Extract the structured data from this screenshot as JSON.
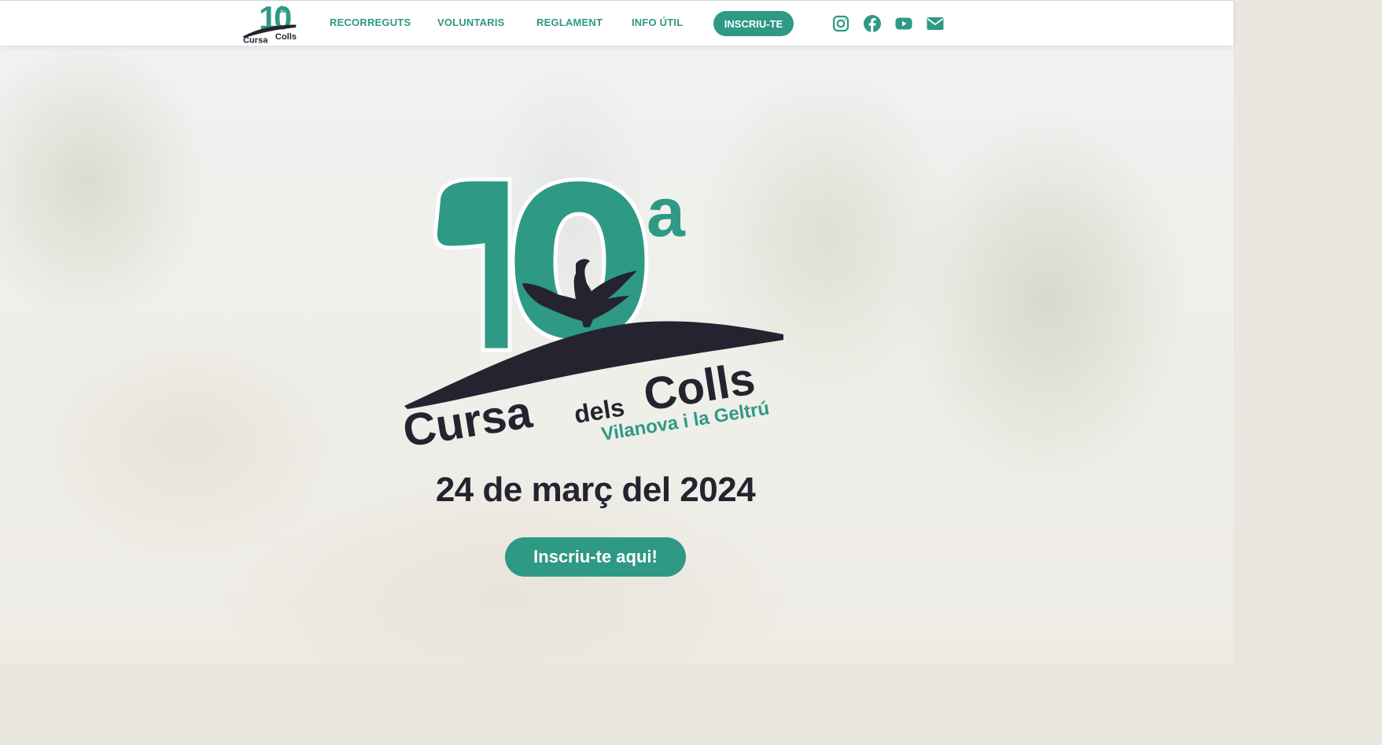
{
  "colors": {
    "accent": "#2e9984",
    "dark": "#25232f",
    "navbar_bg": "#ffffff"
  },
  "navbar": {
    "links": [
      {
        "label": "RECORREGUTS"
      },
      {
        "label": "VOLUNTARIS"
      },
      {
        "label": "REGLAMENT"
      },
      {
        "label": "INFO ÚTIL"
      }
    ],
    "cta_label": "INSCRIU-TE",
    "social": [
      {
        "icon": "instagram-icon"
      },
      {
        "icon": "facebook-icon"
      },
      {
        "icon": "youtube-icon"
      },
      {
        "icon": "email-icon"
      }
    ]
  },
  "logo": {
    "edition": "10",
    "edition_suffix": "a",
    "word1": "Cursa",
    "word2": "dels",
    "word3": "Colls",
    "city": "Vilanova i la Geltrú"
  },
  "hero": {
    "date": "24 de març del 2024",
    "cta_label": "Inscriu-te aqui!"
  }
}
